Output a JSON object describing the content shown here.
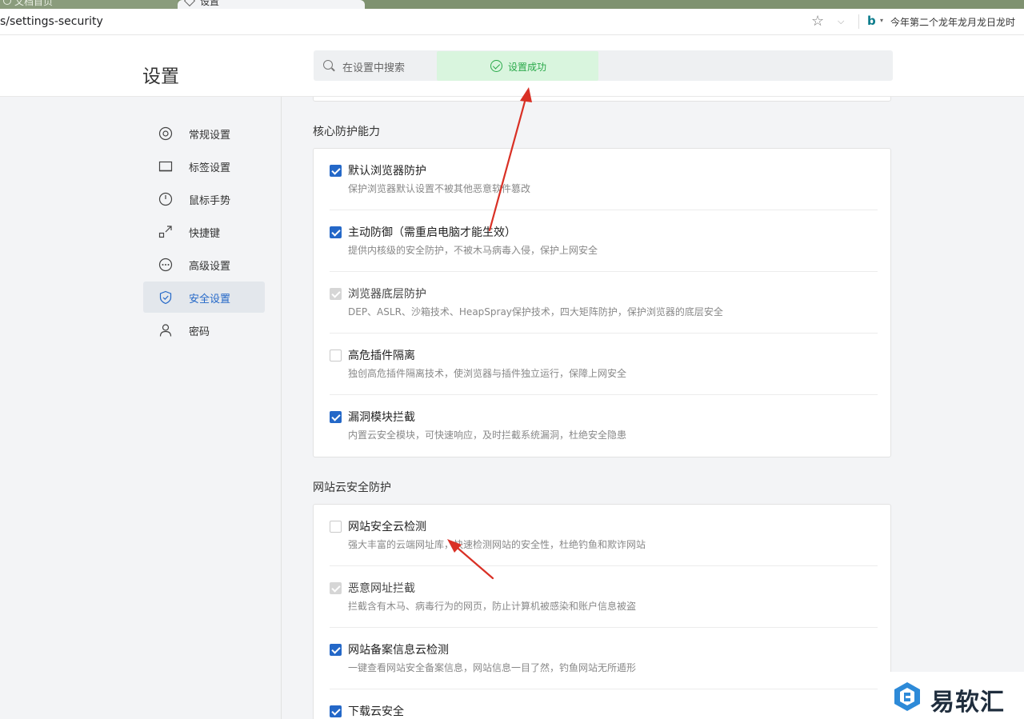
{
  "browser": {
    "tabs": [
      {
        "label": "文档首页"
      },
      {
        "label": "设置"
      }
    ],
    "url": "s/settings-security",
    "star_icon": "star-icon",
    "search_engine_icon": "bing-icon",
    "search_suggestion": "今年第二个龙年龙月龙日龙时"
  },
  "header": {
    "title": "设置",
    "search_placeholder": "在设置中搜索"
  },
  "toast": {
    "text": "设置成功",
    "icon": "check-circle-icon",
    "color": "#2aa94a"
  },
  "sidebar": {
    "items": [
      {
        "label": "常规设置",
        "icon": "general-settings-icon",
        "active": false
      },
      {
        "label": "标签设置",
        "icon": "tab-settings-icon",
        "active": false
      },
      {
        "label": "鼠标手势",
        "icon": "mouse-gesture-icon",
        "active": false
      },
      {
        "label": "快捷键",
        "icon": "shortcut-icon",
        "active": false
      },
      {
        "label": "高级设置",
        "icon": "advanced-settings-icon",
        "active": false
      },
      {
        "label": "安全设置",
        "icon": "shield-icon",
        "active": true
      },
      {
        "label": "密码",
        "icon": "user-icon",
        "active": false
      }
    ],
    "accent_color": "#2468c8"
  },
  "sections": [
    {
      "title": "核心防护能力",
      "options": [
        {
          "title": "默认浏览器防护",
          "desc": "保护浏览器默认设置不被其他恶意软件篡改",
          "state": "checked"
        },
        {
          "title": "主动防御（需重启电脑才能生效）",
          "desc": "提供内核级的安全防护，不被木马病毒入侵，保护上网安全",
          "state": "checked"
        },
        {
          "title": "浏览器底层防护",
          "desc": "DEP、ASLR、沙箱技术、HeapSpray保护技术，四大矩阵防护，保护浏览器的底层安全",
          "state": "disabled"
        },
        {
          "title": "高危插件隔离",
          "desc": "独创高危插件隔离技术，使浏览器与插件独立运行，保障上网安全",
          "state": "unchecked"
        },
        {
          "title": "漏洞模块拦截",
          "desc": "内置云安全模块，可快速响应，及时拦截系统漏洞，杜绝安全隐患",
          "state": "checked"
        }
      ]
    },
    {
      "title": "网站云安全防护",
      "options": [
        {
          "title": "网站安全云检测",
          "desc": "强大丰富的云端网址库，快速检测网站的安全性，杜绝钓鱼和欺诈网站",
          "state": "unchecked"
        },
        {
          "title": "恶意网址拦截",
          "desc": "拦截含有木马、病毒行为的网页，防止计算机被感染和账户信息被盗",
          "state": "disabled"
        },
        {
          "title": "网站备案信息云检测",
          "desc": "一键查看网站安全备案信息，网站信息一目了然，钓鱼网站无所遁形",
          "state": "checked"
        },
        {
          "title": "下载云安全",
          "desc": "",
          "state": "checked"
        }
      ]
    }
  ],
  "annotation_color": "#d93025",
  "watermark": {
    "text": "易软汇",
    "logo": "yiruanhui-logo"
  }
}
